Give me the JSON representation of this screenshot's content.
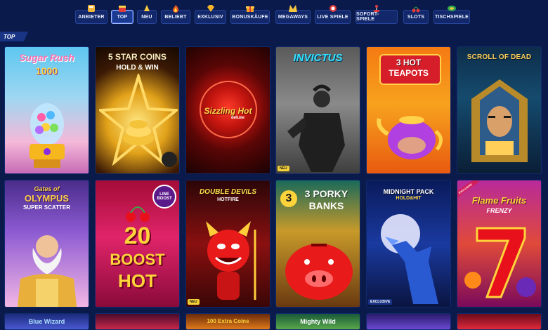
{
  "nav": {
    "tabs": [
      {
        "label": "ANBIETER",
        "icon": "provider-icon"
      },
      {
        "label": "TOP",
        "icon": "top-icon",
        "active": true
      },
      {
        "label": "NEU",
        "icon": "new-icon"
      },
      {
        "label": "BELIEBT",
        "icon": "fire-icon"
      },
      {
        "label": "EXKLUSIV",
        "icon": "diamond-icon"
      },
      {
        "label": "BONUSKÄUFE",
        "icon": "gift-icon"
      },
      {
        "label": "MEGAWAYS",
        "icon": "megaways-icon"
      },
      {
        "label": "LIVE SPIELE",
        "icon": "roulette-icon"
      },
      {
        "label": "SOFORT-SPIELE",
        "icon": "joystick-icon"
      },
      {
        "label": "SLOTS",
        "icon": "cherry-icon"
      },
      {
        "label": "TISCHSPIELE",
        "icon": "table-icon"
      }
    ]
  },
  "section": {
    "title": "TOP"
  },
  "games": [
    {
      "title": "Sugar Rush 1000",
      "line1": "Sugar Rush",
      "line2": "1000"
    },
    {
      "title": "5 Star Coins Hold & Win",
      "line1": "5 STAR COINS",
      "line2": "HOLD & WIN"
    },
    {
      "title": "Sizzling Hot Deluxe",
      "line1": "Sizzling Hot",
      "line2": "deluxe"
    },
    {
      "title": "Invictus",
      "line1": "INVICTUS",
      "line2": "",
      "badge": "NEU"
    },
    {
      "title": "3 Hot Teapots",
      "line1": "3 HOT",
      "line2": "TEAPOTS"
    },
    {
      "title": "Scroll of Dead",
      "line1": "SCROLL OF DEAD",
      "line2": ""
    },
    {
      "title": "Gates of Olympus Super Scatter",
      "line1": "Gates of",
      "line2": "OLYMPUS",
      "line3": "SUPER SCATTER"
    },
    {
      "title": "20 Boost Hot",
      "line1": "20",
      "line2": "BOOST",
      "line3": "HOT",
      "tag": "LINE BOOST"
    },
    {
      "title": "Double Devils Hotfire",
      "line1": "DOUBLE DEVILS",
      "line2": "HOTFIRE",
      "badge": "NEU"
    },
    {
      "title": "3 Porky Banks",
      "line1": "3 PORKY",
      "line2": "BANKS"
    },
    {
      "title": "Midnight Pack Hold & Hit",
      "line1": "MIDNIGHT PACK",
      "line2": "HOLD&HIT",
      "badge": "EXCLUSIVE"
    },
    {
      "title": "Flame Fruits Frenzy",
      "line1": "Flame Fruits",
      "line2": "FRENZY",
      "ribbon": "EXCLUSIVE"
    }
  ],
  "bottom_row": [
    "Blue Wizard",
    "",
    "100 Extra Coins",
    "Mighty Wild",
    "",
    ""
  ],
  "colors": {
    "bg": "#0a1a4a",
    "tab_bg": "#12286a",
    "tab_active_border": "#9fb7ff",
    "badge_new": "#f4d23a"
  }
}
